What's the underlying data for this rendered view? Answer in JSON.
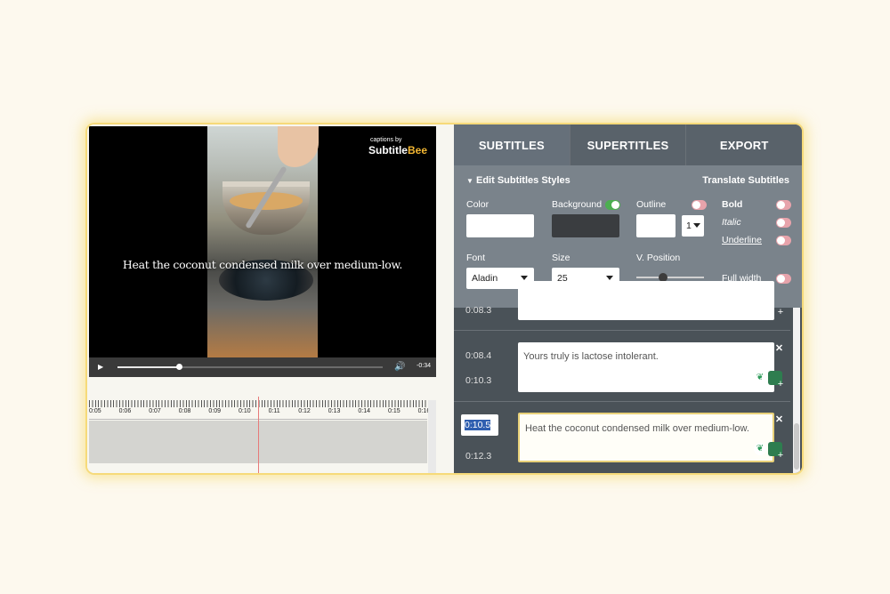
{
  "video": {
    "caption": "Heat the coconut condensed milk over medium-low.",
    "watermark_small": "captions by",
    "watermark_brand_a": "Subtitle",
    "watermark_brand_b": "Bee",
    "time_remaining": "-0:34",
    "progress": 0.23
  },
  "timeline": {
    "labels": [
      "0:05",
      "0:06",
      "0:07",
      "0:08",
      "0:09",
      "0:10",
      "0:11",
      "0:12",
      "0:13",
      "0:14",
      "0:15",
      "0:16"
    ]
  },
  "tabs": {
    "subtitles": "SUBTITLES",
    "supertitles": "SUPERTITLES",
    "export": "EXPORT"
  },
  "styles": {
    "header": "Edit Subtitles Styles",
    "translate": "Translate Subtitles",
    "color_label": "Color",
    "background_label": "Background",
    "outline_label": "Outline",
    "outline_width": "1",
    "bold_label": "Bold",
    "italic_label": "Italic",
    "underline_label": "Underline",
    "font_label": "Font",
    "font_value": "Aladin",
    "size_label": "Size",
    "size_value": "25",
    "vposition_label": "V. Position",
    "vposition_level": 0.4,
    "fullwidth_label": "Full width",
    "background_enabled": true,
    "colors": {
      "color": "#ffffff",
      "background": "#3a3d40"
    }
  },
  "rows": [
    {
      "start": "0:08.3",
      "end": "",
      "text": ""
    },
    {
      "start": "0:08.4",
      "end": "0:10.3",
      "text": "Yours truly is lactose intolerant."
    },
    {
      "start": "0:10.5",
      "end": "0:12.3",
      "text": "Heat the coconut condensed milk over medium-low."
    }
  ]
}
